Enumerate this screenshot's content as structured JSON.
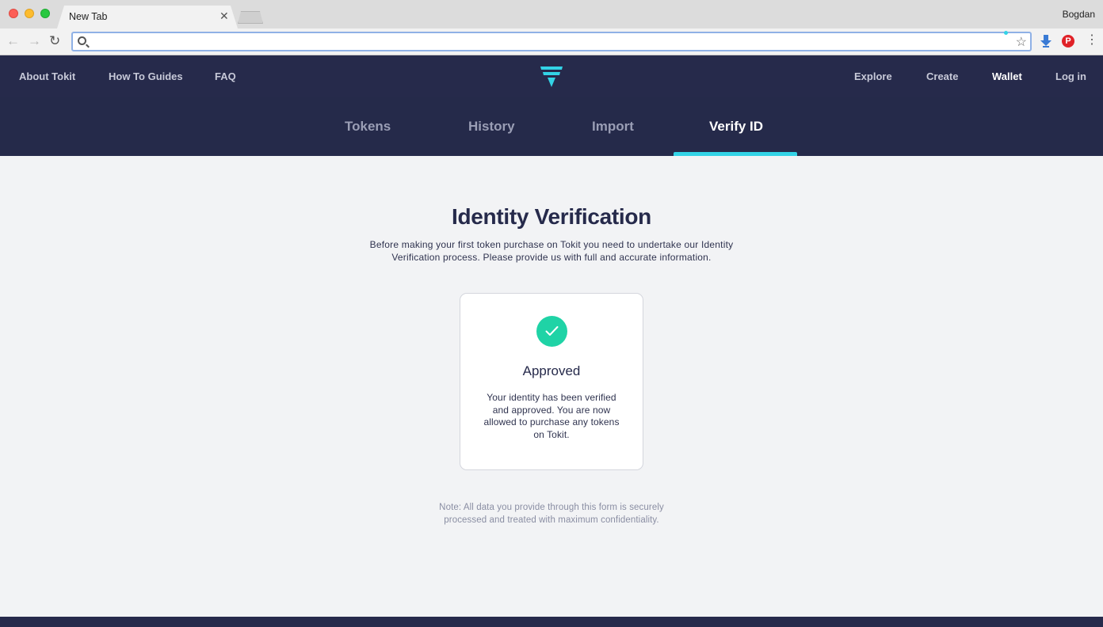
{
  "browser": {
    "tab_title": "New Tab",
    "tab_close": "✕",
    "profile_name": "Bogdan",
    "address_value": "",
    "icons": [
      "back-arrow-icon",
      "forward-arrow-icon",
      "reload-icon",
      "search-icon",
      "star-icon",
      "extension-icon",
      "pinterest-icon",
      "menu-icon"
    ]
  },
  "header": {
    "left_nav": [
      "About Tokit",
      "How To Guides",
      "FAQ"
    ],
    "right_nav": [
      "Explore",
      "Create",
      "Wallet",
      "Log in"
    ],
    "active": "Wallet"
  },
  "subnav": {
    "tabs": [
      "Tokens",
      "History",
      "Import",
      "Verify ID"
    ],
    "active": "Verify ID"
  },
  "main": {
    "title": "Identity Verification",
    "description": "Before making your first token purchase on Tokit you need to undertake our Identity Verification process. Please provide us with full and accurate information.",
    "status_card": {
      "title": "Approved",
      "body": "Your identity has been verified and approved. You are now allowed to purchase any tokens on Tokit."
    },
    "note": "Note: All data you provide through this form is securely processed and treated with maximum confidentiality."
  },
  "colors": {
    "navy": "#262a4b",
    "accent": "#33d3e6",
    "success": "#1fd3a6"
  }
}
